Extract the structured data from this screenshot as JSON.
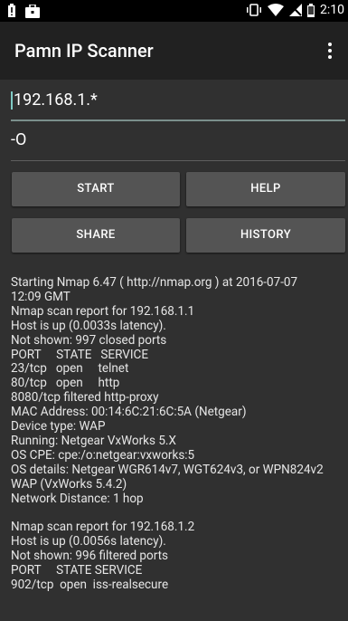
{
  "status_bar": {
    "time": "2:10",
    "left_icons": [
      "battery-alert-icon",
      "briefcase-icon"
    ],
    "right_icons": [
      "vibrate-icon",
      "wifi-icon",
      "no-signal-icon",
      "battery-icon"
    ]
  },
  "app_bar": {
    "title": "Pamn IP Scanner"
  },
  "inputs": {
    "ip_range": "192.168.1.*",
    "options": "-O"
  },
  "buttons": {
    "start": "START",
    "help": "HELP",
    "share": "SHARE",
    "history": "HISTORY"
  },
  "output_lines": [
    "Starting Nmap 6.47 ( http://nmap.org ) at 2016-07-07",
    "12:09 GMT",
    "Nmap scan report for 192.168.1.1",
    "Host is up (0.0033s latency).",
    "Not shown: 997 closed ports",
    "PORT     STATE   SERVICE",
    "23/tcp   open     telnet",
    "80/tcp   open     http",
    "8080/tcp filtered http-proxy",
    "MAC Address: 00:14:6C:21:6C:5A (Netgear)",
    "Device type: WAP",
    "Running: Netgear VxWorks 5.X",
    "OS CPE: cpe:/o:netgear:vxworks:5",
    "OS details: Netgear WGR614v7, WGT624v3, or WPN824v2",
    "WAP (VxWorks 5.4.2)",
    "Network Distance: 1 hop",
    "",
    "Nmap scan report for 192.168.1.2",
    "Host is up (0.0056s latency).",
    "Not shown: 996 filtered ports",
    "PORT     STATE SERVICE",
    "902/tcp  open  iss-realsecure"
  ],
  "colors": {
    "background": "#303030",
    "app_bar": "#212121",
    "button": "#545454",
    "accent_cursor": "#80cbc4"
  }
}
